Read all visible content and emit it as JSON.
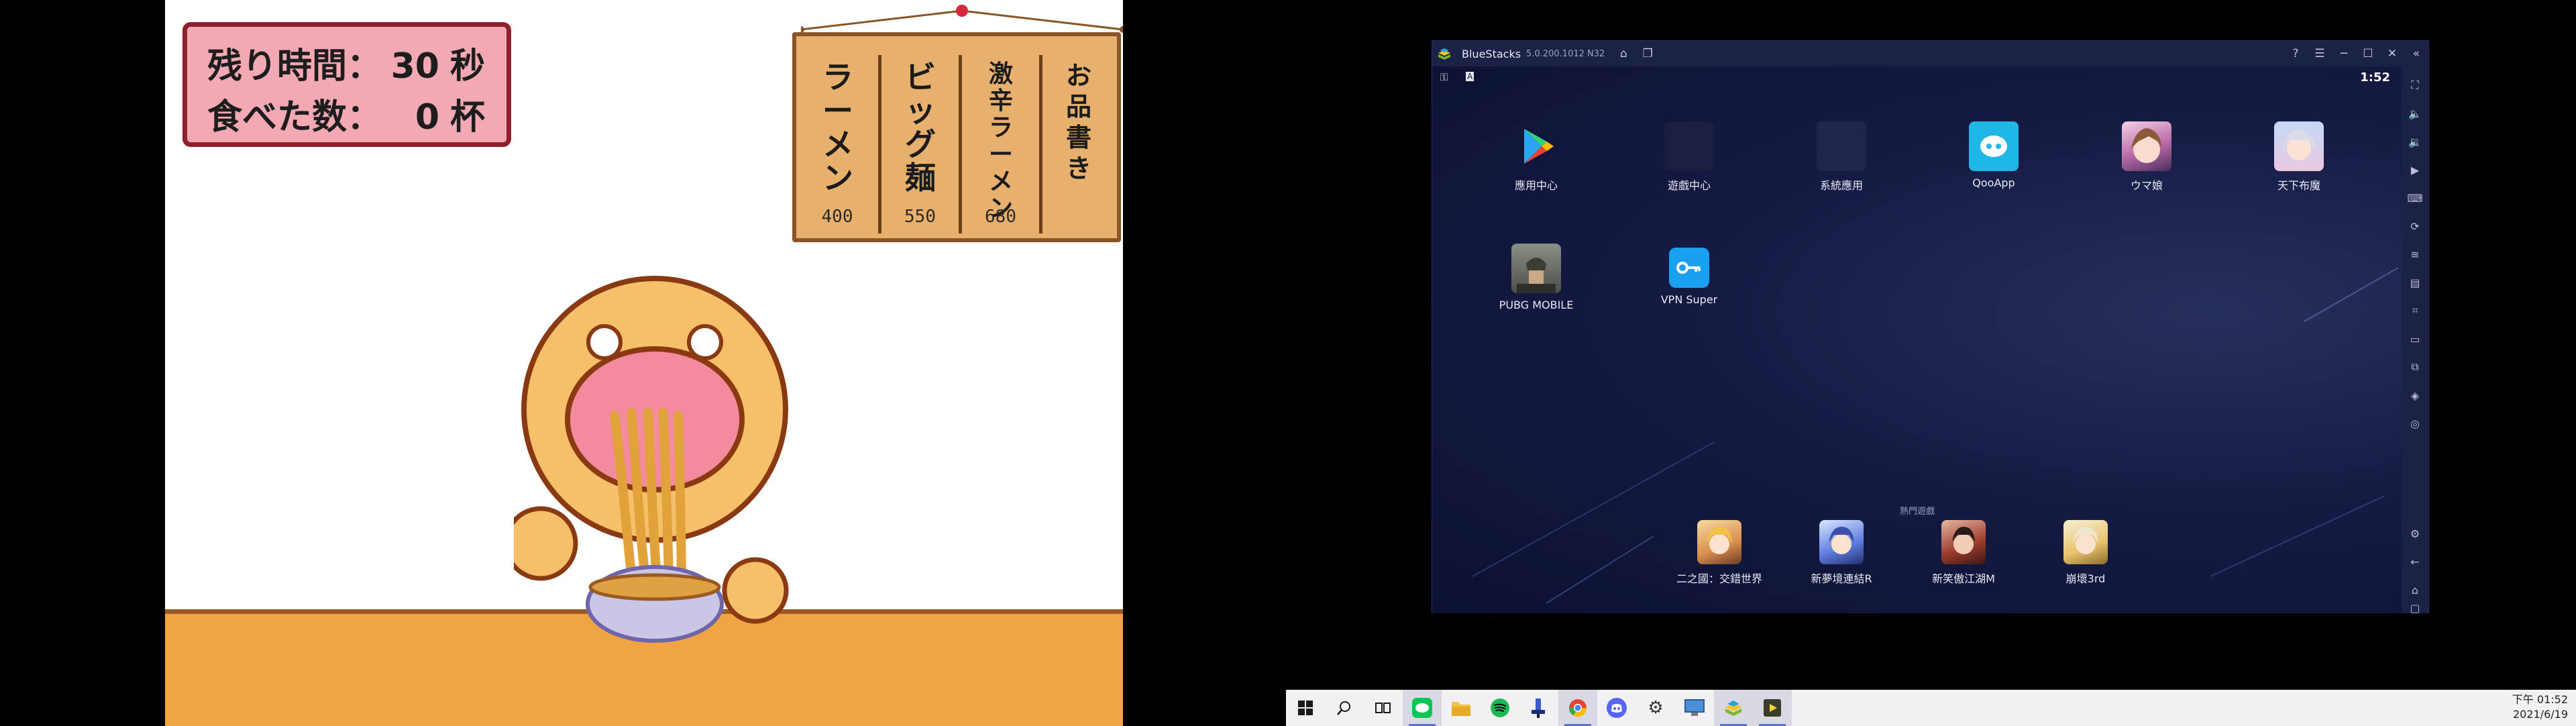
{
  "game": {
    "hud": {
      "time_label": "残り時間：",
      "time_value": "30",
      "time_unit": "秒",
      "count_label": "食べた数：",
      "count_value": "0",
      "count_unit": "杯"
    },
    "menu": [
      {
        "name": "お品書き",
        "price": ""
      },
      {
        "name": "激辛ラーメン",
        "price": "680"
      },
      {
        "name": "ビッグ麺",
        "price": "550"
      },
      {
        "name": "ラーメン",
        "price": "400"
      }
    ]
  },
  "bluestacks": {
    "title": "BlueStacks",
    "version": "5.0.200.1012 N32",
    "clock": "1:52",
    "apps": [
      {
        "label": "應用中心",
        "icon": "play-store-icon"
      },
      {
        "label": "遊戲中心",
        "icon": "game-center-icon"
      },
      {
        "label": "系統應用",
        "icon": "system-apps-icon"
      },
      {
        "label": "QooApp",
        "icon": "qooapp-icon"
      },
      {
        "label": "ウマ娘",
        "icon": "umamusume-icon"
      },
      {
        "label": "天下布魔",
        "icon": "tenka-fuma-icon"
      },
      {
        "label": "PUBG MOBILE",
        "icon": "pubg-icon"
      },
      {
        "label": "VPN Super",
        "icon": "vpn-key-icon"
      }
    ],
    "hot_games_label": "熱門遊戲",
    "dock": [
      {
        "label": "二之國：交錯世界",
        "icon": "ni-no-kuni-icon"
      },
      {
        "label": "新夢境連結R",
        "icon": "dream-link-icon"
      },
      {
        "label": "新笑傲江湖M",
        "icon": "swordsman-icon"
      },
      {
        "label": "崩壞3rd",
        "icon": "honkai-icon"
      }
    ],
    "colors": {
      "accent": "#1fb7e5",
      "titlebar": "#1c2146",
      "screen": "#11173d"
    }
  },
  "taskbar": {
    "apps": [
      {
        "name": "start-icon"
      },
      {
        "name": "search-icon"
      },
      {
        "name": "task-view-icon"
      },
      {
        "name": "line-icon",
        "active": true
      },
      {
        "name": "file-explorer-icon"
      },
      {
        "name": "spotify-icon"
      },
      {
        "name": "paint-icon"
      },
      {
        "name": "chrome-icon",
        "active": true
      },
      {
        "name": "discord-icon"
      },
      {
        "name": "settings-icon"
      },
      {
        "name": "remote-desktop-icon"
      },
      {
        "name": "bluestacks-icon",
        "active": true
      },
      {
        "name": "media-player-icon",
        "active": true
      }
    ],
    "time": "下午 01:52",
    "date": "2021/6/19"
  }
}
